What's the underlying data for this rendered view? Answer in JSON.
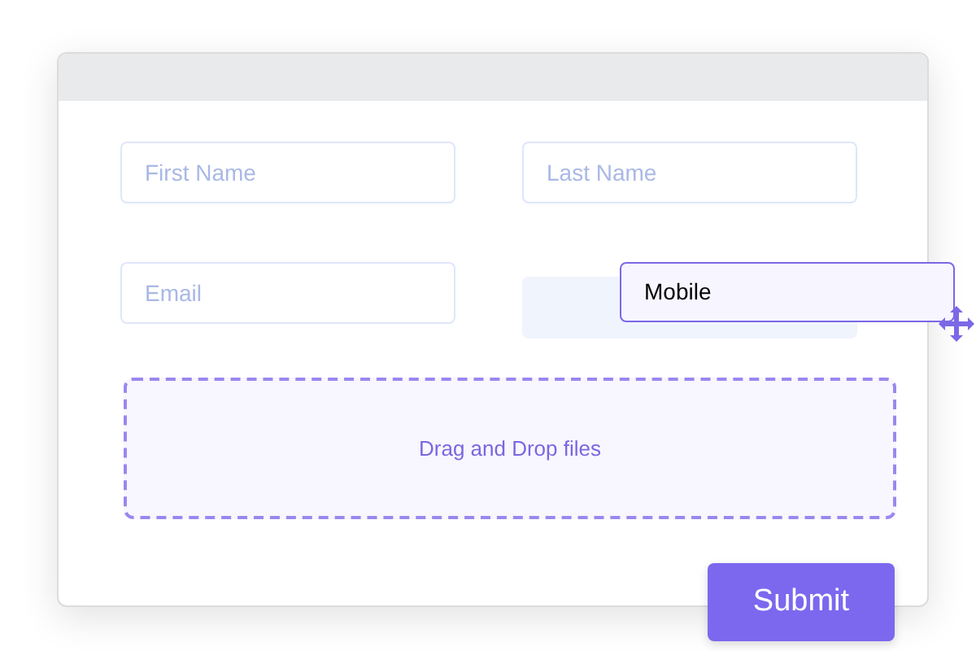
{
  "form": {
    "fields": [
      {
        "placeholder": "First Name"
      },
      {
        "placeholder": "Last Name"
      },
      {
        "placeholder": "Email"
      }
    ],
    "drop_zone": {
      "label": "Drag and Drop files"
    },
    "dragged_field": {
      "label": "Mobile"
    },
    "submit_button": {
      "label": "Submit"
    }
  }
}
